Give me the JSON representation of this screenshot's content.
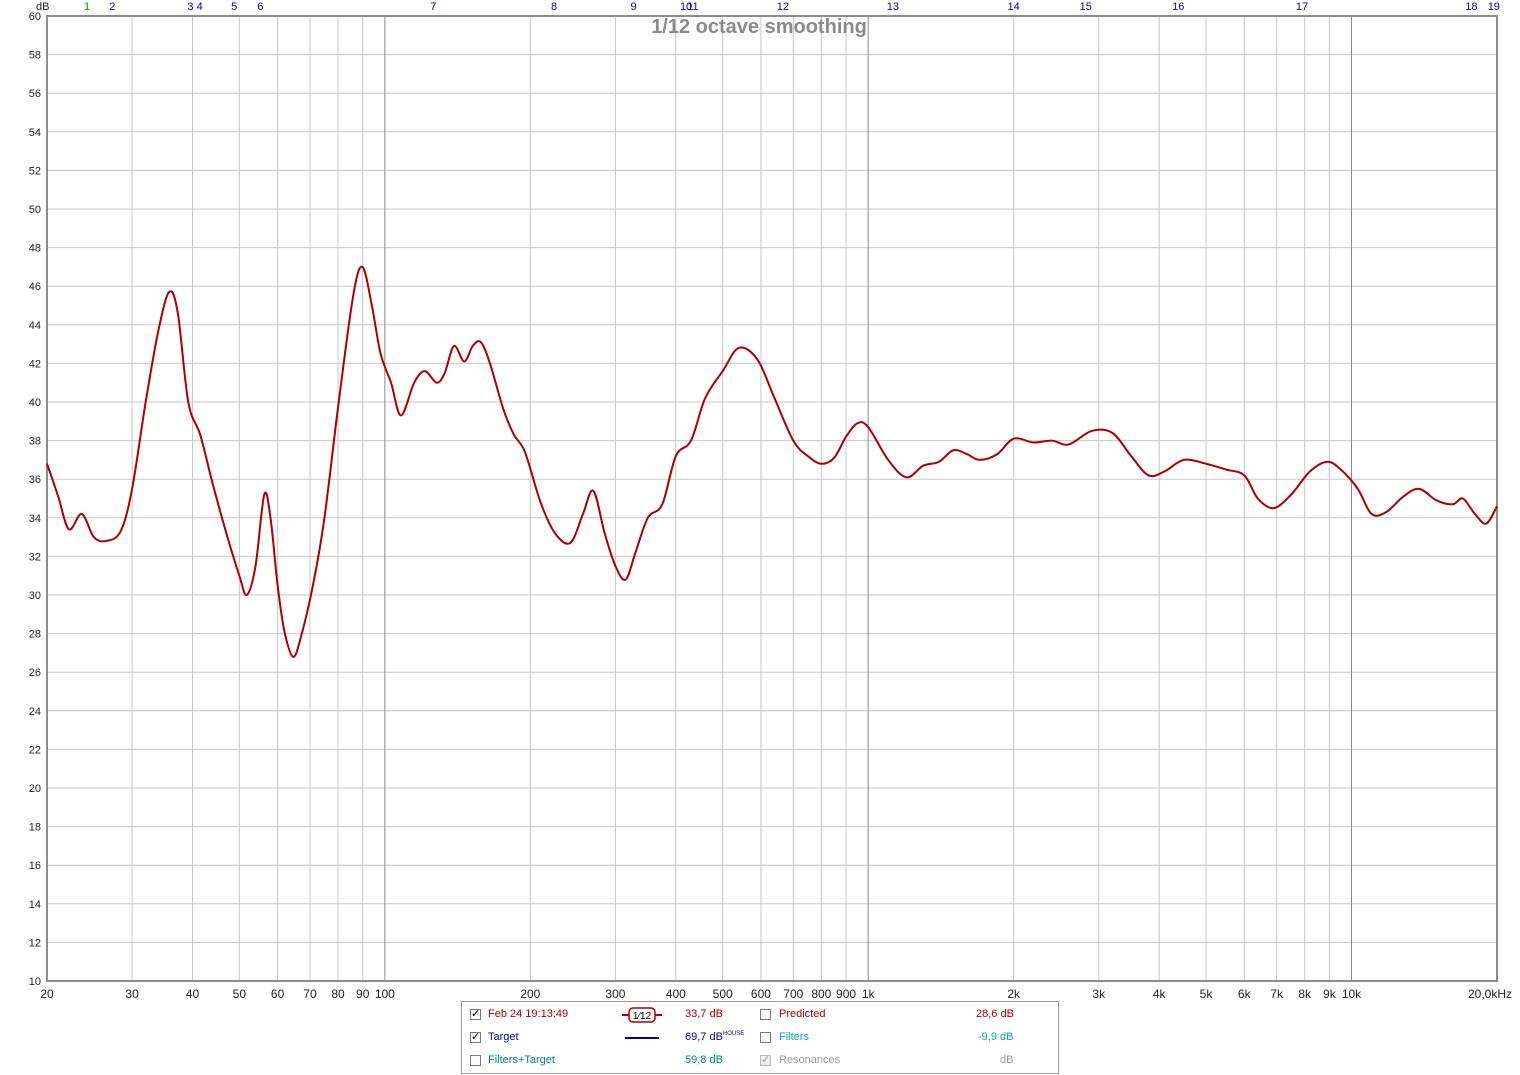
{
  "chart_data": {
    "type": "line",
    "title": "1/12 octave smoothing",
    "y_unit_label": "dB",
    "x_unit_label": "20,0kHz",
    "x_scale": "log",
    "xlim": [
      20,
      20000
    ],
    "ylim": [
      10,
      60
    ],
    "grid": true,
    "y_ticks": [
      "10",
      "12",
      "14",
      "16",
      "18",
      "20",
      "22",
      "24",
      "26",
      "28",
      "30",
      "32",
      "34",
      "36",
      "38",
      "40",
      "42",
      "44",
      "46",
      "48",
      "50",
      "52",
      "54",
      "56",
      "58",
      "60"
    ],
    "x_ticks": [
      {
        "f": 20,
        "label": "20"
      },
      {
        "f": 30,
        "label": "30"
      },
      {
        "f": 40,
        "label": "40"
      },
      {
        "f": 50,
        "label": "50"
      },
      {
        "f": 60,
        "label": "60"
      },
      {
        "f": 70,
        "label": "70"
      },
      {
        "f": 80,
        "label": "80"
      },
      {
        "f": 90,
        "label": "90"
      },
      {
        "f": 100,
        "label": "100"
      },
      {
        "f": 200,
        "label": "200"
      },
      {
        "f": 300,
        "label": "300"
      },
      {
        "f": 400,
        "label": "400"
      },
      {
        "f": 500,
        "label": "500"
      },
      {
        "f": 600,
        "label": "600"
      },
      {
        "f": 700,
        "label": "700"
      },
      {
        "f": 800,
        "label": "800"
      },
      {
        "f": 900,
        "label": "900"
      },
      {
        "f": 1000,
        "label": "1k"
      },
      {
        "f": 2000,
        "label": "2k"
      },
      {
        "f": 3000,
        "label": "3k"
      },
      {
        "f": 4000,
        "label": "4k"
      },
      {
        "f": 5000,
        "label": "5k"
      },
      {
        "f": 6000,
        "label": "6k"
      },
      {
        "f": 7000,
        "label": "7k"
      },
      {
        "f": 8000,
        "label": "8k"
      },
      {
        "f": 9000,
        "label": "9k"
      },
      {
        "f": 10000,
        "label": "10k"
      }
    ],
    "filter_markers": [
      {
        "label": "1",
        "f": 24.2,
        "color": "#009900"
      },
      {
        "label": "2",
        "f": 27.3,
        "color": "#0000cc"
      },
      {
        "label": "3",
        "f": 39.6,
        "color": "#0000cc"
      },
      {
        "label": "4",
        "f": 41.4,
        "color": "#0000cc"
      },
      {
        "label": "5",
        "f": 48.8,
        "color": "#0000cc"
      },
      {
        "label": "6",
        "f": 55.3,
        "color": "#0000cc"
      },
      {
        "label": "7",
        "f": 126,
        "color": "#0000cc"
      },
      {
        "label": "8",
        "f": 224,
        "color": "#0000cc"
      },
      {
        "label": "9",
        "f": 327,
        "color": "#0000cc"
      },
      {
        "label": "10",
        "f": 420,
        "color": "#0000cc"
      },
      {
        "label": "11",
        "f": 434,
        "color": "#0000cc"
      },
      {
        "label": "12",
        "f": 666,
        "color": "#0000cc"
      },
      {
        "label": "13",
        "f": 1125,
        "color": "#0000cc"
      },
      {
        "label": "14",
        "f": 2000,
        "color": "#0000cc"
      },
      {
        "label": "15",
        "f": 2820,
        "color": "#0000cc"
      },
      {
        "label": "16",
        "f": 4380,
        "color": "#0000cc"
      },
      {
        "label": "17",
        "f": 7900,
        "color": "#0000cc"
      },
      {
        "label": "18",
        "f": 17700,
        "color": "#0000cc"
      },
      {
        "label": "19",
        "f": 19700,
        "color": "#0000cc"
      }
    ],
    "series": [
      {
        "name": "Feb 24 19:13:49",
        "color": "#aa0000",
        "points": [
          [
            20,
            36.8
          ],
          [
            21.1,
            35.1
          ],
          [
            22.2,
            33.4
          ],
          [
            23.6,
            34.2
          ],
          [
            25.0,
            33.0
          ],
          [
            26.5,
            32.8
          ],
          [
            28.4,
            33.3
          ],
          [
            30.0,
            35.5
          ],
          [
            32.0,
            40.0
          ],
          [
            34.0,
            43.7
          ],
          [
            35.8,
            45.7
          ],
          [
            37.3,
            44.6
          ],
          [
            39.2,
            40.0
          ],
          [
            41.5,
            38.3
          ],
          [
            44.0,
            35.8
          ],
          [
            47.0,
            33.2
          ],
          [
            50.0,
            31.0
          ],
          [
            51.8,
            30.0
          ],
          [
            54.0,
            31.5
          ],
          [
            56.3,
            35.2
          ],
          [
            58.0,
            34.0
          ],
          [
            60.0,
            30.5
          ],
          [
            62.0,
            28.1
          ],
          [
            64.6,
            26.8
          ],
          [
            67.0,
            27.8
          ],
          [
            71.0,
            30.5
          ],
          [
            75.0,
            34.0
          ],
          [
            80.0,
            39.7
          ],
          [
            86.0,
            45.5
          ],
          [
            89.9,
            47.0
          ],
          [
            94.0,
            45.0
          ],
          [
            98.0,
            42.5
          ],
          [
            103.0,
            41.0
          ],
          [
            108.0,
            39.3
          ],
          [
            115.0,
            41.0
          ],
          [
            121.0,
            41.6
          ],
          [
            128.0,
            41.0
          ],
          [
            133.0,
            41.5
          ],
          [
            139.0,
            42.9
          ],
          [
            146.0,
            42.1
          ],
          [
            152.0,
            42.9
          ],
          [
            158.0,
            43.1
          ],
          [
            165.0,
            42.0
          ],
          [
            176.0,
            39.6
          ],
          [
            185.0,
            38.3
          ],
          [
            195.0,
            37.4
          ],
          [
            210.0,
            34.8
          ],
          [
            225.0,
            33.2
          ],
          [
            242.0,
            32.7
          ],
          [
            257.0,
            34.2
          ],
          [
            270.0,
            35.4
          ],
          [
            285.0,
            33.2
          ],
          [
            300.0,
            31.5
          ],
          [
            315.0,
            30.8
          ],
          [
            330.0,
            32.2
          ],
          [
            350.0,
            34.0
          ],
          [
            375.0,
            34.7
          ],
          [
            400.0,
            37.2
          ],
          [
            430.0,
            38.0
          ],
          [
            460.0,
            40.2
          ],
          [
            500.0,
            41.6
          ],
          [
            540.0,
            42.8
          ],
          [
            590.0,
            42.2
          ],
          [
            640.0,
            40.2
          ],
          [
            700.0,
            38.0
          ],
          [
            750.0,
            37.2
          ],
          [
            800.0,
            36.8
          ],
          [
            850.0,
            37.1
          ],
          [
            900.0,
            38.2
          ],
          [
            950.0,
            38.9
          ],
          [
            1000.0,
            38.7
          ],
          [
            1100.0,
            37.0
          ],
          [
            1200.0,
            36.1
          ],
          [
            1300.0,
            36.7
          ],
          [
            1400.0,
            36.9
          ],
          [
            1500.0,
            37.5
          ],
          [
            1600.0,
            37.3
          ],
          [
            1700.0,
            37.0
          ],
          [
            1850.0,
            37.3
          ],
          [
            2000.0,
            38.1
          ],
          [
            2200.0,
            37.9
          ],
          [
            2400.0,
            38.0
          ],
          [
            2600.0,
            37.8
          ],
          [
            2900.0,
            38.5
          ],
          [
            3200.0,
            38.4
          ],
          [
            3500.0,
            37.2
          ],
          [
            3800.0,
            36.2
          ],
          [
            4100.0,
            36.4
          ],
          [
            4500.0,
            37.0
          ],
          [
            5000.0,
            36.8
          ],
          [
            5500.0,
            36.5
          ],
          [
            6000.0,
            36.2
          ],
          [
            6400.0,
            35.0
          ],
          [
            6900.0,
            34.5
          ],
          [
            7500.0,
            35.2
          ],
          [
            8200.0,
            36.4
          ],
          [
            8900.0,
            36.9
          ],
          [
            9500.0,
            36.5
          ],
          [
            10300.0,
            35.5
          ],
          [
            11000.0,
            34.2
          ],
          [
            11800.0,
            34.3
          ],
          [
            12800.0,
            35.1
          ],
          [
            13800.0,
            35.5
          ],
          [
            15000.0,
            34.9
          ],
          [
            16200.0,
            34.7
          ],
          [
            17000.0,
            35.0
          ],
          [
            18000.0,
            34.2
          ],
          [
            19000.0,
            33.7
          ],
          [
            20000.0,
            34.6
          ]
        ]
      }
    ]
  },
  "legend": {
    "rows": [
      {
        "check": "✓",
        "checked": true,
        "label": "Feb 24 19:13:49",
        "label_color": "#aa0000",
        "value": "33,7 dB",
        "value_color": "#aa0000",
        "check2": "",
        "label2": "Predicted",
        "label2_color": "#aa0000",
        "value2": "28,6 dB",
        "value2_color": "#aa0000"
      },
      {
        "check": "✓",
        "checked": true,
        "label": "Target",
        "label_color": "#0000aa",
        "value": "69,7 dB",
        "value_color": "#0000aa",
        "value_sup": "HOUSE",
        "check2": "",
        "label2": "Filters",
        "label2_color": "#00aaaa",
        "value2": "-9,9 dB",
        "value2_color": "#00aaaa"
      },
      {
        "check": "",
        "checked": false,
        "label": "Filters+Target",
        "label_color": "#008888",
        "value": "59,8 dB",
        "value_color": "#008888",
        "check2": "✓",
        "label2": "Resonances",
        "label2_color": "#9a9a9a",
        "value2": "dB",
        "value2_color": "#9a9a9a"
      }
    ],
    "smoothing_badge": "1⁄12"
  }
}
